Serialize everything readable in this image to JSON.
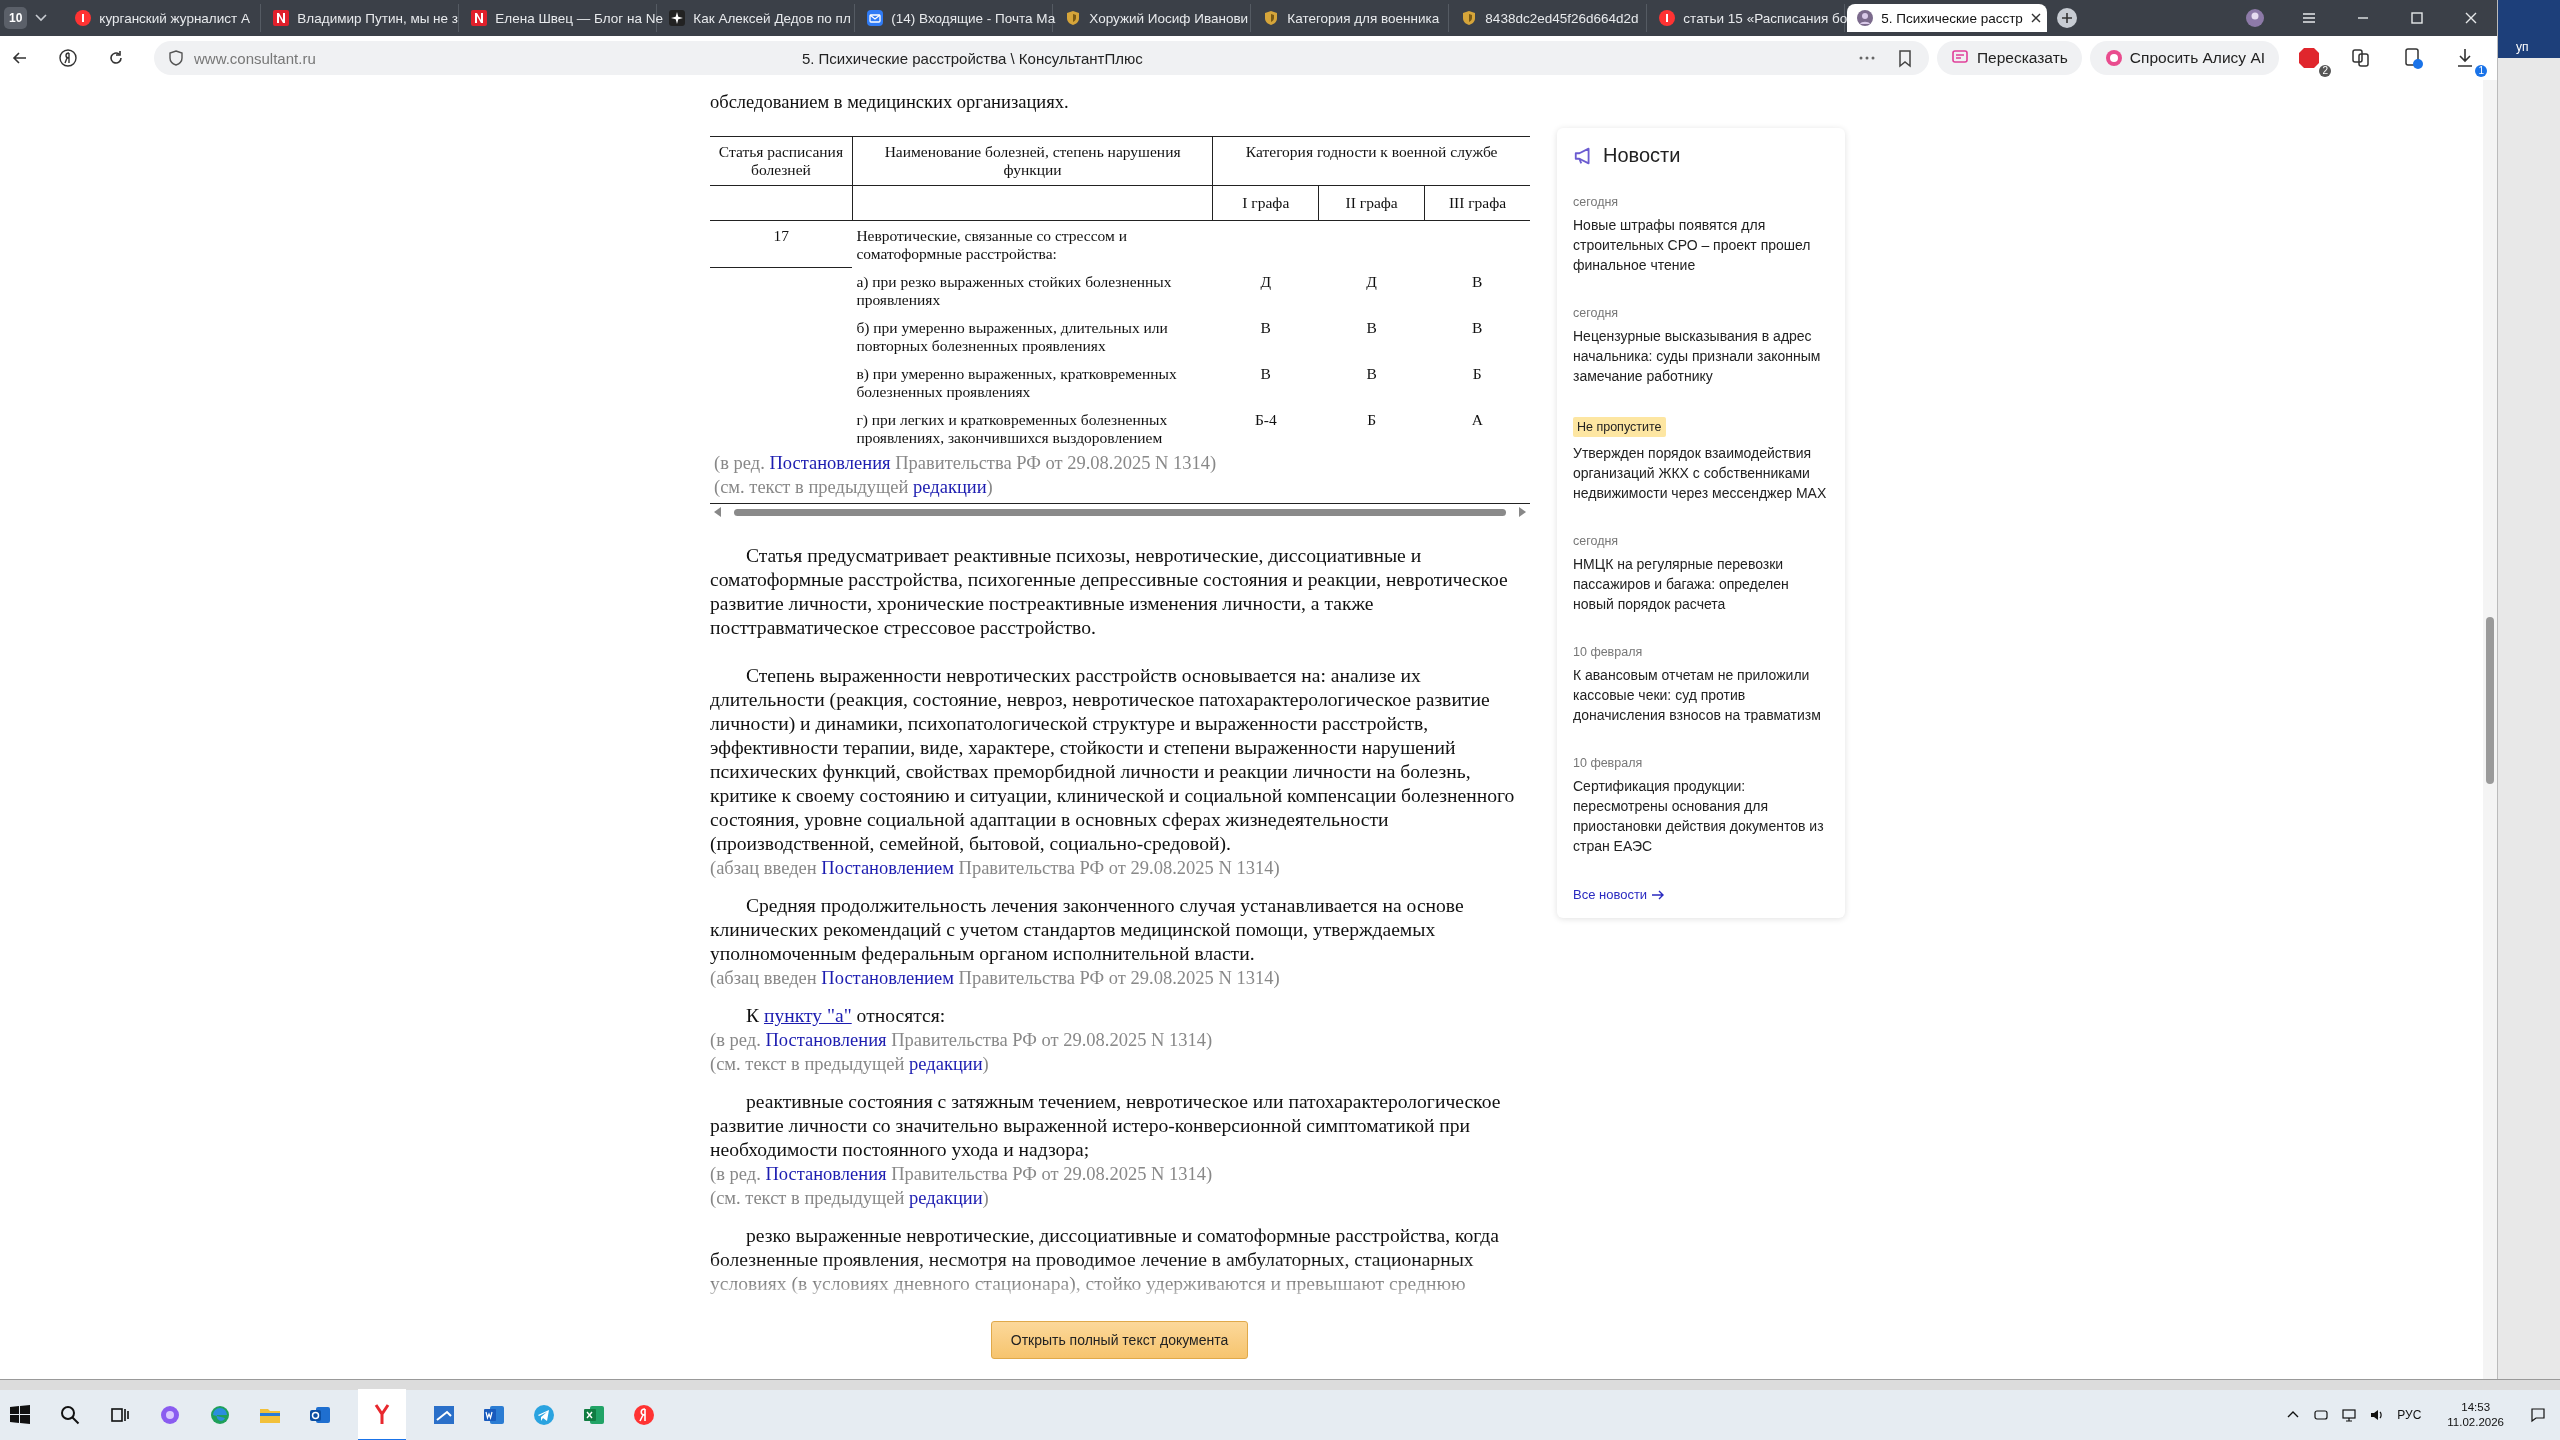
{
  "tab_count": "10",
  "tabs": [
    {
      "kind": "circle",
      "title": "курганский журналист А",
      "selected": false
    },
    {
      "kind": "square",
      "title": "Владимир Путин, мы не з",
      "selected": false
    },
    {
      "kind": "square",
      "title": "Елена Швец — Блог на Ne",
      "selected": false
    },
    {
      "kind": "star",
      "title": "Как Алексей Дедов по пл",
      "selected": false
    },
    {
      "kind": "envelope",
      "title": "(14) Входящие - Почта Ма",
      "selected": false
    },
    {
      "kind": "shield",
      "title": "Хоружий Иосиф Иванови",
      "selected": false
    },
    {
      "kind": "shield",
      "title": "Категория для военника",
      "selected": false
    },
    {
      "kind": "shield",
      "title": "8438dc2ed45f26d664d2d",
      "selected": false
    },
    {
      "kind": "circle",
      "title": "статьи 15 «Расписания бо",
      "selected": false
    },
    {
      "kind": "avatar",
      "title": "5. Психические расстр",
      "selected": true
    }
  ],
  "address_bar": {
    "url": "www.consultant.ru",
    "page_title": "5. Психические расстройства \\ КонсультантПлюс",
    "retell_button": "Пересказать",
    "ask_button": "Спросить Алису AI",
    "extension_badge": "2",
    "download_badge": "1"
  },
  "document": {
    "lead": "обследованием в медицинских организациях.",
    "table": {
      "headers": [
        "Статья расписания болезней",
        "Наименование болезней, степень нарушения функции",
        "Категория годности к военной службе"
      ],
      "subheaders": [
        "I графа",
        "II графа",
        "III графа"
      ],
      "article": "17",
      "title": "Невротические, связанные со стрессом и соматоформные расстройства:",
      "rows": [
        {
          "text": "а) при резко выраженных стойких болезненных проявлениях",
          "values": [
            "Д",
            "Д",
            "В"
          ]
        },
        {
          "text": "б) при умеренно выраженных, длительных или повторных болезненных проявлениях",
          "values": [
            "В",
            "В",
            "В"
          ]
        },
        {
          "text": "в) при умеренно выраженных, кратковременных болезненных проявлениях",
          "values": [
            "В",
            "В",
            "Б"
          ]
        },
        {
          "text": "г) при легких и кратковременных болезненных проявлениях, закончившихся выздоровлением",
          "values": [
            "Б-4",
            "Б",
            "А"
          ]
        }
      ]
    },
    "table_notes": [
      {
        "parts": [
          {
            "text": "(в ред. ",
            "link": false
          },
          {
            "text": "Постановления",
            "link": true
          },
          {
            "text": " Правительства РФ от 29.08.2025 N 1314)",
            "link": false
          }
        ]
      },
      {
        "parts": [
          {
            "text": "(см. текст в предыдущей ",
            "link": false
          },
          {
            "text": "редакции",
            "link": true
          },
          {
            "text": ")",
            "link": false
          }
        ]
      }
    ],
    "blocks": [
      {
        "kind": "paragraph",
        "faded": false,
        "parts": [
          {
            "text": "Статья предусматривает реактивные психозы, невротические, диссоциативные и соматоформные расстройства, психогенные депрессивные состояния и реакции, невротическое развитие личности, хронические постреактивные изменения личности, а также посттравматическое стрессовое расстройство.",
            "link": false
          }
        ]
      },
      {
        "kind": "paragraph",
        "faded": false,
        "parts": [
          {
            "text": "Степень выраженности невротических расстройств основывается на: анализе их длительности (реакция, состояние, невроз, невротическое патохарактерологическое развитие личности) и динамики, психопатологической структуре и выраженности расстройств, эффективности терапии, виде, характере, стойкости и степени выраженности нарушений психических функций, свойствах преморбидной личности и реакции личности на болезнь, критике к своему состоянию и ситуации, клинической и социальной компенсации болезненного состояния, уровне социальной адаптации в основных сферах жизнедеятельности (производственной, семейной, бытовой, социально-средовой).",
            "link": false
          }
        ]
      },
      {
        "kind": "note",
        "faded": false,
        "parts": [
          {
            "text": "(абзац введен ",
            "link": false
          },
          {
            "text": "Постановлением",
            "link": true
          },
          {
            "text": " Правительства РФ от 29.08.2025 N 1314)",
            "link": false
          }
        ]
      },
      {
        "kind": "paragraph",
        "faded": false,
        "parts": [
          {
            "text": "Средняя продолжительность лечения законченного случая устанавливается на основе клинических рекомендаций с учетом стандартов медицинской помощи, утверждаемых уполномоченным федеральным органом исполнительной власти.",
            "link": false
          }
        ]
      },
      {
        "kind": "note",
        "faded": false,
        "parts": [
          {
            "text": "(абзац введен ",
            "link": false
          },
          {
            "text": "Постановлением",
            "link": true
          },
          {
            "text": " Правительства РФ от 29.08.2025 N 1314)",
            "link": false
          }
        ]
      },
      {
        "kind": "paragraph",
        "faded": false,
        "parts": [
          {
            "text": "К ",
            "link": false
          },
          {
            "text": "пункту \"а\"",
            "link": true
          },
          {
            "text": " относятся:",
            "link": false
          }
        ]
      },
      {
        "kind": "note",
        "faded": false,
        "parts": [
          {
            "text": "(в ред. ",
            "link": false
          },
          {
            "text": "Постановления",
            "link": true
          },
          {
            "text": " Правительства РФ от 29.08.2025 N 1314)",
            "link": false
          }
        ]
      },
      {
        "kind": "note",
        "faded": false,
        "parts": [
          {
            "text": "(см. текст в предыдущей ",
            "link": false
          },
          {
            "text": "редакции",
            "link": true
          },
          {
            "text": ")",
            "link": false
          }
        ]
      },
      {
        "kind": "paragraph",
        "faded": false,
        "parts": [
          {
            "text": "реактивные состояния с затяжным течением, невротическое или патохарактерологическое развитие личности со значительно выраженной истеро-конверсионной симптоматикой при необходимости постоянного ухода и надзора;",
            "link": false
          }
        ]
      },
      {
        "kind": "note",
        "faded": false,
        "parts": [
          {
            "text": "(в ред. ",
            "link": false
          },
          {
            "text": "Постановления",
            "link": true
          },
          {
            "text": " Правительства РФ от 29.08.2025 N 1314)",
            "link": false
          }
        ]
      },
      {
        "kind": "note",
        "faded": false,
        "parts": [
          {
            "text": "(см. текст в предыдущей ",
            "link": false
          },
          {
            "text": "редакции",
            "link": true
          },
          {
            "text": ")",
            "link": false
          }
        ]
      },
      {
        "kind": "paragraph",
        "faded": true,
        "parts": [
          {
            "text": "резко выраженные невротические, диссоциативные и соматоформные расстройства, когда болезненные проявления, несмотря на проводимое лечение в амбулаторных, стационарных условиях (в условиях дневного стационара), стойко удерживаются и превышают среднюю",
            "link": false
          }
        ]
      }
    ],
    "open_button": "Открыть полный текст документа"
  },
  "news": {
    "title": "Новости",
    "items": [
      {
        "kind": "date",
        "label": "сегодня",
        "title": "Новые штрафы появятся для строительных СРО – проект прошел финальное чтение"
      },
      {
        "kind": "date",
        "label": "сегодня",
        "title": "Нецензурные высказывания в адрес начальника: суды признали законным замечание работнику"
      },
      {
        "kind": "badge",
        "label": "Не пропустите",
        "title": "Утвержден порядок взаимодействия организаций ЖКХ с собственниками недвижимости через мессенджер MAX"
      },
      {
        "kind": "date",
        "label": "сегодня",
        "title": "НМЦК на регулярные перевозки пассажиров и багажа: определен новый порядок расчета"
      },
      {
        "kind": "date",
        "label": "10 февраля",
        "title": "К авансовым отчетам не приложили кассовые чеки: суд против доначисления взносов на травматизм"
      },
      {
        "kind": "date",
        "label": "10 февраля",
        "title": "Сертификация продукции: пересмотрены основания для приостановки действия документов из стран ЕАЭС"
      }
    ],
    "all_link": "Все новости"
  },
  "behind_window": {
    "text": "уп"
  },
  "taskbar": {
    "language": "РУС",
    "time": "14:53",
    "date": "11.02.2026"
  }
}
